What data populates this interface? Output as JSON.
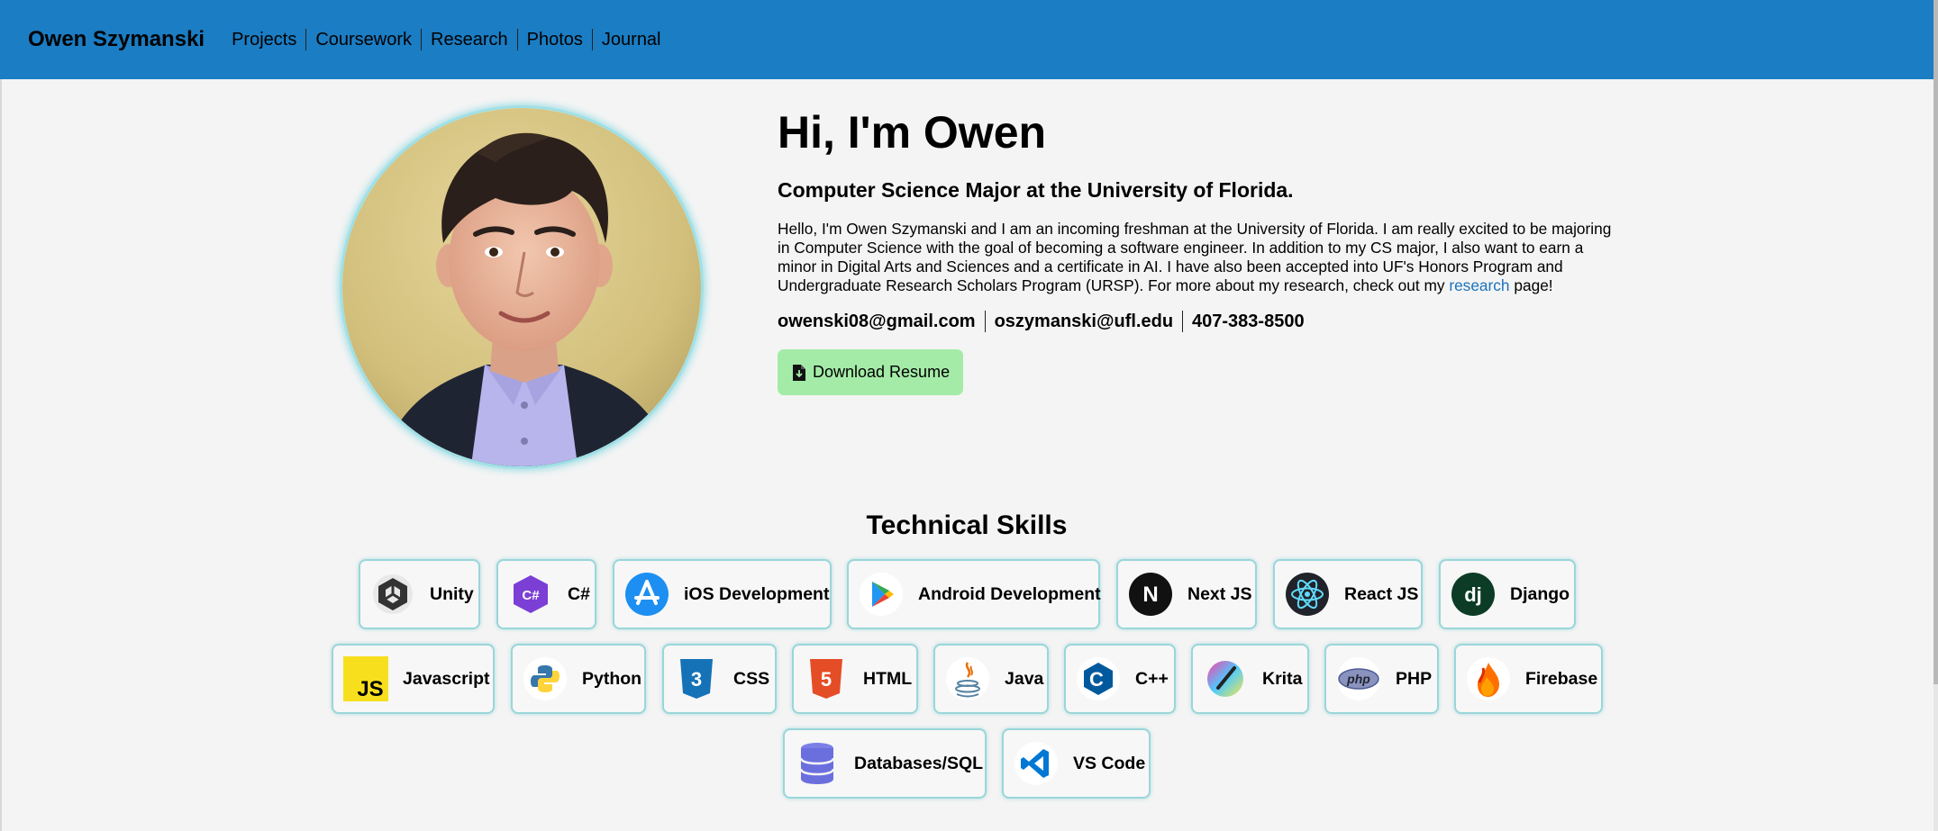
{
  "nav": {
    "brand": "Owen Szymanski",
    "links": [
      "Projects",
      "Coursework",
      "Research",
      "Photos",
      "Journal"
    ]
  },
  "hero": {
    "title": "Hi, I'm Owen",
    "subtitle": "Computer Science Major at the University of Florida.",
    "bio_before": "Hello, I'm Owen Szymanski and I am an incoming freshman at the University of Florida. I am really excited to be majoring in Computer Science with the goal of becoming a software engineer. In addition to my CS major, I also want to earn a minor in Digital Arts and Sciences and a certificate in AI. I have also been accepted into UF's Honors Program and Undergraduate Research Scholars Program (URSP). For more about my research, check out my ",
    "bio_link": "research",
    "bio_after": " page!",
    "contacts": [
      "owenski08@gmail.com",
      "oszymanski@ufl.edu",
      "407-383-8500"
    ],
    "resume_label": "Download Resume"
  },
  "skills": {
    "title": "Technical Skills",
    "items": [
      {
        "label": "Unity",
        "icon": "unity-icon"
      },
      {
        "label": "C#",
        "icon": "csharp-icon"
      },
      {
        "label": "iOS Development",
        "icon": "app-store-icon"
      },
      {
        "label": "Android Development",
        "icon": "google-play-icon"
      },
      {
        "label": "Next JS",
        "icon": "nextjs-icon"
      },
      {
        "label": "React JS",
        "icon": "react-icon"
      },
      {
        "label": "Django",
        "icon": "django-icon"
      },
      {
        "label": "Javascript",
        "icon": "javascript-icon"
      },
      {
        "label": "Python",
        "icon": "python-icon"
      },
      {
        "label": "CSS",
        "icon": "css-icon"
      },
      {
        "label": "HTML",
        "icon": "html-icon"
      },
      {
        "label": "Java",
        "icon": "java-icon"
      },
      {
        "label": "C++",
        "icon": "cpp-icon"
      },
      {
        "label": "Krita",
        "icon": "krita-icon"
      },
      {
        "label": "PHP",
        "icon": "php-icon"
      },
      {
        "label": "Firebase",
        "icon": "firebase-icon"
      },
      {
        "label": "Databases/SQL",
        "icon": "database-icon"
      },
      {
        "label": "VS Code",
        "icon": "vscode-icon"
      }
    ]
  },
  "icon_texts": {
    "csharp": "C#",
    "nextjs": "N",
    "django": "dj",
    "javascript": "JS",
    "css": "3",
    "html": "5",
    "cpp": "C",
    "php": "php"
  },
  "colors": {
    "nav_bg": "#1b7dc3",
    "page_bg": "#f4f4f4",
    "resume_btn": "#a4eba8",
    "skill_border": "#9ad6da",
    "link": "#1b72bd"
  }
}
